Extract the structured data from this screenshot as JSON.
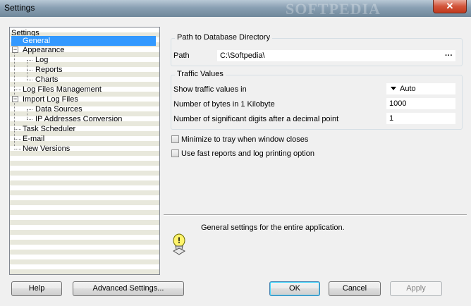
{
  "window": {
    "title": "Settings",
    "watermark": "SOFTPEDIA",
    "close_glyph": "✕"
  },
  "tree": {
    "items": [
      {
        "label": "Settings"
      },
      {
        "label": "General"
      },
      {
        "label": "Appearance",
        "expander": "−"
      },
      {
        "label": "Log"
      },
      {
        "label": "Reports"
      },
      {
        "label": "Charts"
      },
      {
        "label": "Log Files Management"
      },
      {
        "label": "Import Log Files",
        "expander": "−"
      },
      {
        "label": "Data Sources"
      },
      {
        "label": "IP Addresses Conversion"
      },
      {
        "label": "Task Scheduler"
      },
      {
        "label": "E-mail"
      },
      {
        "label": "New Versions"
      }
    ]
  },
  "database": {
    "group_title": "Path to Database Directory",
    "path_label": "Path",
    "path_value": "C:\\Softpedia\\",
    "browse_glyph": "···"
  },
  "traffic": {
    "group_title": "Traffic Values",
    "show_label": "Show traffic values in",
    "show_value": "Auto",
    "bytes_label": "Number of bytes in 1 Kilobyte",
    "bytes_value": "1000",
    "digits_label": "Number of significant digits after a decimal point",
    "digits_value": "1"
  },
  "options": {
    "minimize_label": "Minimize to tray when window closes",
    "fast_reports_label": "Use fast reports and log printing option"
  },
  "description": {
    "text": "General settings for the entire application.",
    "icon_glyph": "!"
  },
  "buttons": {
    "help": "Help",
    "advanced": "Advanced Settings...",
    "ok": "OK",
    "cancel": "Cancel",
    "apply": "Apply"
  },
  "colors": {
    "selection": "#3399ff",
    "titlebar": "#8aa0b3"
  }
}
